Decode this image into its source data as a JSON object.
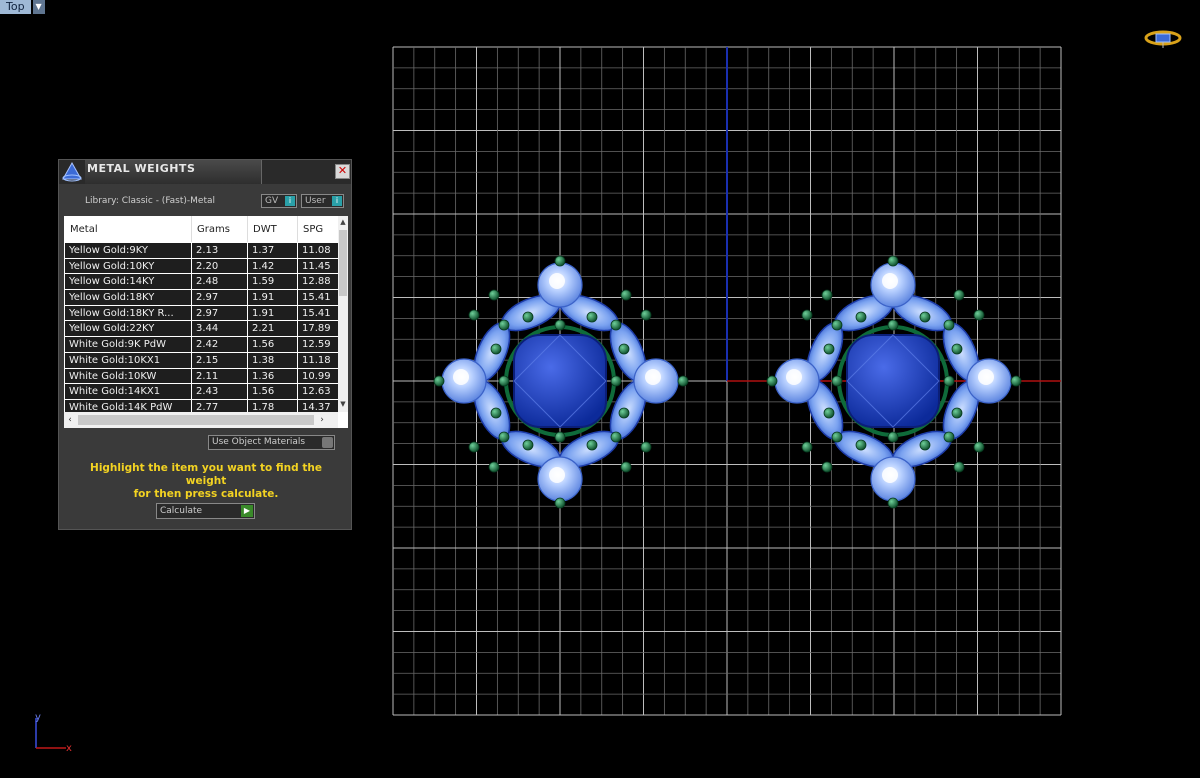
{
  "viewport": {
    "name": "Top"
  },
  "dialog": {
    "title": "METAL WEIGHTS",
    "library": "Library: Classic - (Fast)-Metal",
    "gv_label": "GV",
    "user_label": "User",
    "columns": [
      "Metal",
      "Grams",
      "DWT",
      "SPG"
    ],
    "rows": [
      [
        "Yellow Gold:9KY",
        "2.13",
        "1.37",
        "11.08"
      ],
      [
        "Yellow Gold:10KY",
        "2.20",
        "1.42",
        "11.45"
      ],
      [
        "Yellow Gold:14KY",
        "2.48",
        "1.59",
        "12.88"
      ],
      [
        "Yellow Gold:18KY",
        "2.97",
        "1.91",
        "15.41"
      ],
      [
        "Yellow Gold:18KY R...",
        "2.97",
        "1.91",
        "15.41"
      ],
      [
        "Yellow Gold:22KY",
        "3.44",
        "2.21",
        "17.89"
      ],
      [
        "White Gold:9K PdW",
        "2.42",
        "1.56",
        "12.59"
      ],
      [
        "White Gold:10KX1",
        "2.15",
        "1.38",
        "11.18"
      ],
      [
        "White Gold:10KW",
        "2.11",
        "1.36",
        "10.99"
      ],
      [
        "White Gold:14KX1",
        "2.43",
        "1.56",
        "12.63"
      ],
      [
        "White Gold:14K PdW",
        "2.77",
        "1.78",
        "14.37"
      ]
    ],
    "use_object_materials": "Use Object Materials",
    "hint_line1": "Highlight the item you want to find the weight",
    "hint_line2": "for then press calculate.",
    "calculate": "Calculate"
  },
  "axis": {
    "y_label": "y",
    "x_label": "x"
  },
  "colors": {
    "grid": "#bdbdbd",
    "background": "#000000",
    "y_axis": "#1a2fb0",
    "x_axis": "#b01010",
    "hint_text": "#f3d322",
    "sapphire": "#1f3fb8",
    "emerald": "#0f6b3a"
  }
}
